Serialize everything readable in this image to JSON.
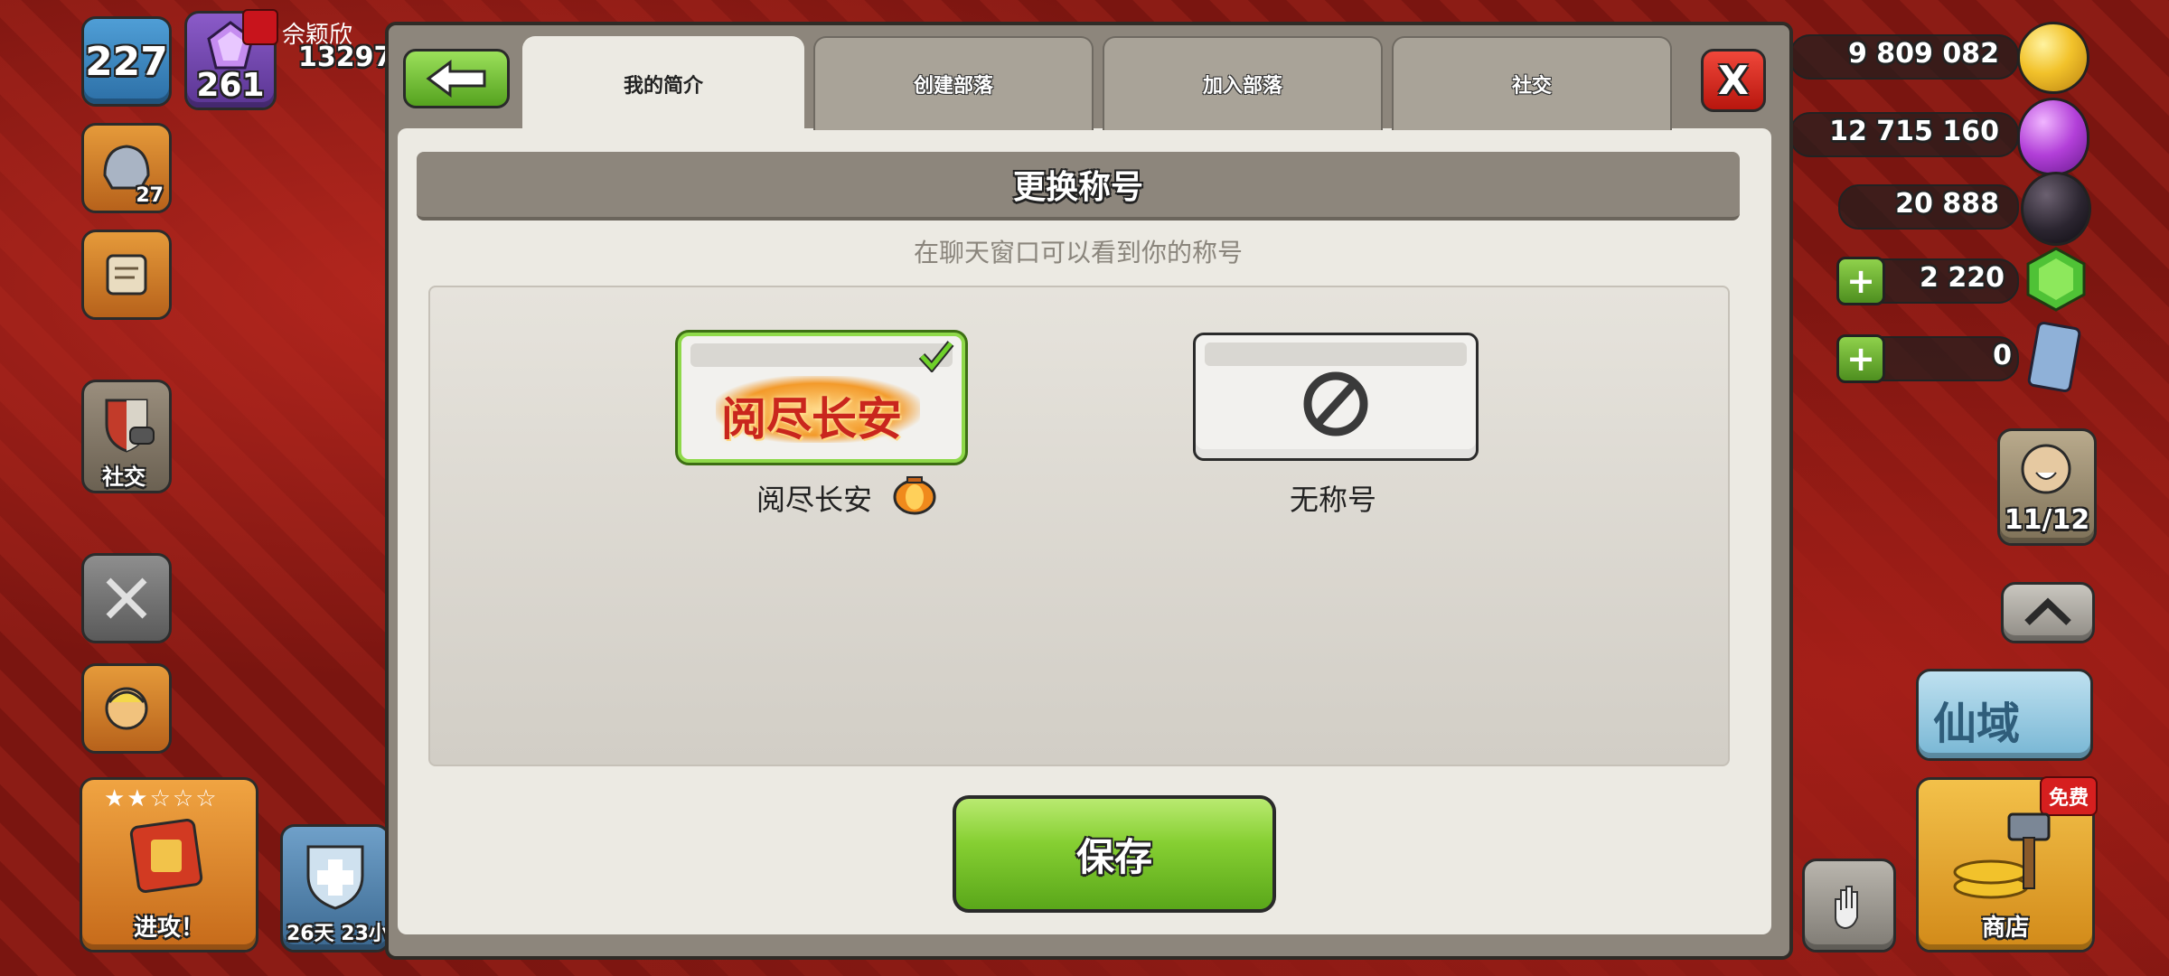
{
  "hud_left": {
    "player_level": "227",
    "trophy_count": "261",
    "player_name": "佘颖欣",
    "player_score": "13297(",
    "magic_badge": "27",
    "social_label": "社交",
    "attack_label": "进攻！",
    "shield_timer": "26天 23小"
  },
  "hud_right": {
    "gold": "9 809 082",
    "elixir": "12 715 160",
    "dark_elixir": "20 888",
    "gems": "2 220",
    "tickets": "0",
    "builders": "11/12",
    "event_banner": "仙域",
    "shop_badge": "免费",
    "shop_label": "商店",
    "colors": {
      "gold": "#f2c22b",
      "elixir": "#b23fd8",
      "dark": "#2b2530",
      "gem": "#4fc236"
    }
  },
  "dialog": {
    "tabs": [
      {
        "label": "我的简介",
        "active": true
      },
      {
        "label": "创建部落",
        "active": false
      },
      {
        "label": "加入部落",
        "active": false
      },
      {
        "label": "社交",
        "active": false
      }
    ],
    "close_label": "X",
    "header": "更换称号",
    "subtitle": "在聊天窗口可以看到你的称号",
    "titles": [
      {
        "label": "阅尽长安",
        "banner_text": "阅尽长安",
        "selected": true
      },
      {
        "label": "无称号",
        "selected": false
      }
    ],
    "save_label": "保存",
    "accent_green": "#86cf32"
  }
}
